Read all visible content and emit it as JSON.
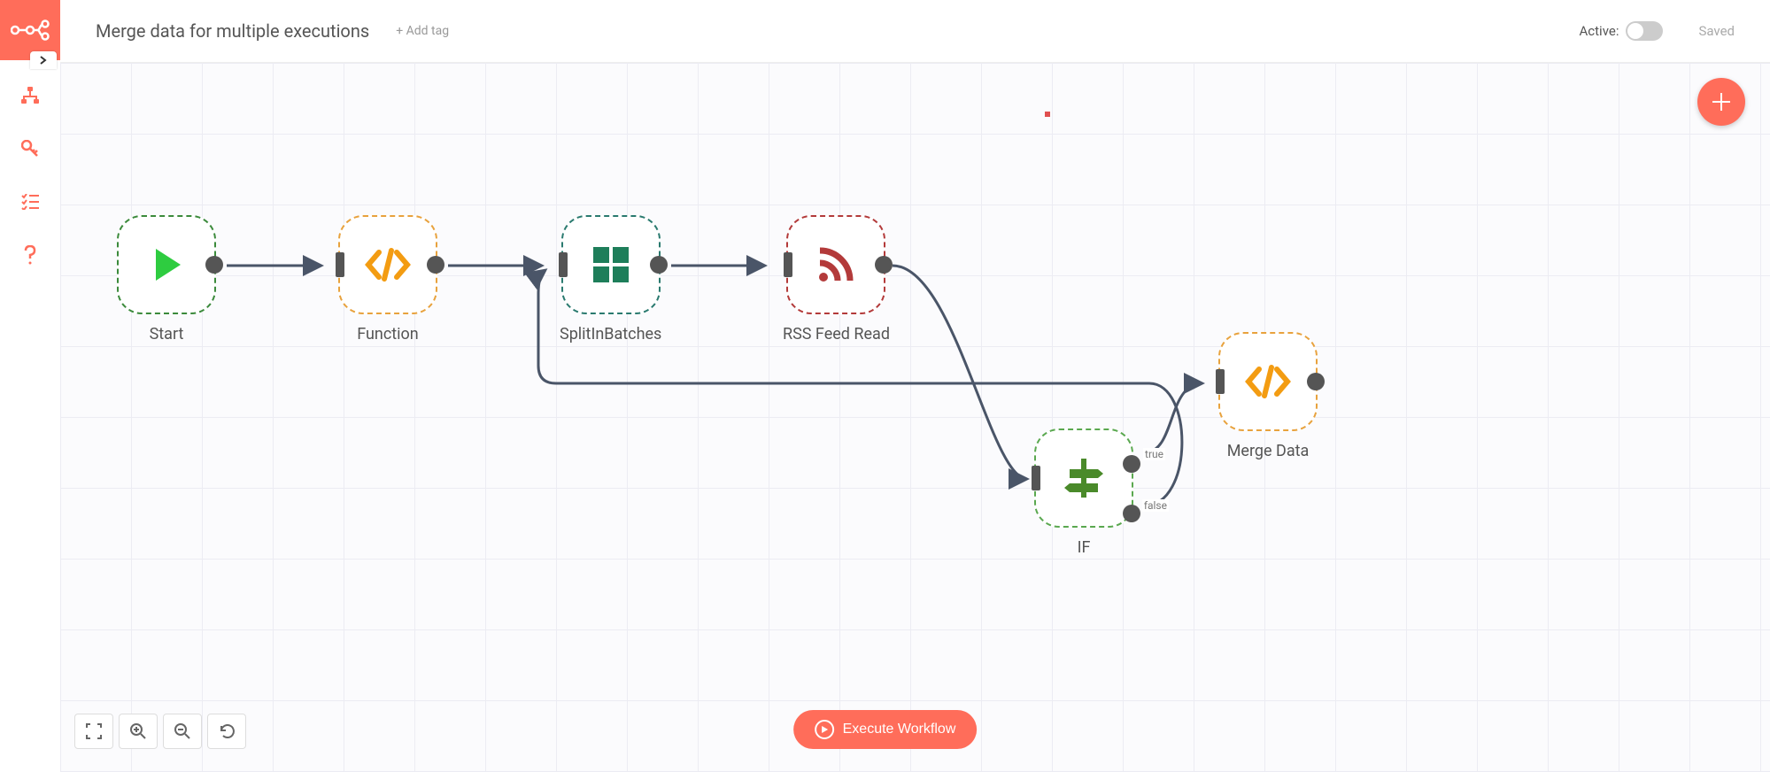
{
  "header": {
    "title": "Merge data for multiple executions",
    "add_tag": "+ Add tag",
    "active_label": "Active:",
    "saved": "Saved"
  },
  "sidebar": {
    "icons": [
      "workflows",
      "credentials",
      "executions",
      "help"
    ]
  },
  "canvas": {
    "execute_label": "Execute Workflow",
    "nodes": [
      {
        "id": "start",
        "label": "Start",
        "type": "trigger",
        "color": "green",
        "icon": "play"
      },
      {
        "id": "function",
        "label": "Function",
        "type": "function",
        "color": "orange",
        "icon": "code"
      },
      {
        "id": "split",
        "label": "SplitInBatches",
        "type": "split",
        "color": "teal",
        "icon": "grid"
      },
      {
        "id": "rss",
        "label": "RSS Feed Read",
        "type": "rss",
        "color": "red",
        "icon": "rss"
      },
      {
        "id": "if",
        "label": "IF",
        "type": "if",
        "color": "lgreen",
        "icon": "branch",
        "outputs": [
          "true",
          "false"
        ]
      },
      {
        "id": "merge",
        "label": "Merge Data",
        "type": "function",
        "color": "orange",
        "icon": "code"
      }
    ],
    "connections": [
      {
        "from": "start",
        "to": "function"
      },
      {
        "from": "function",
        "to": "split"
      },
      {
        "from": "split",
        "to": "rss"
      },
      {
        "from": "rss",
        "to": "if"
      },
      {
        "from": "if",
        "output": "true",
        "to": "merge"
      },
      {
        "from": "if",
        "output": "false",
        "to": "split"
      }
    ]
  }
}
